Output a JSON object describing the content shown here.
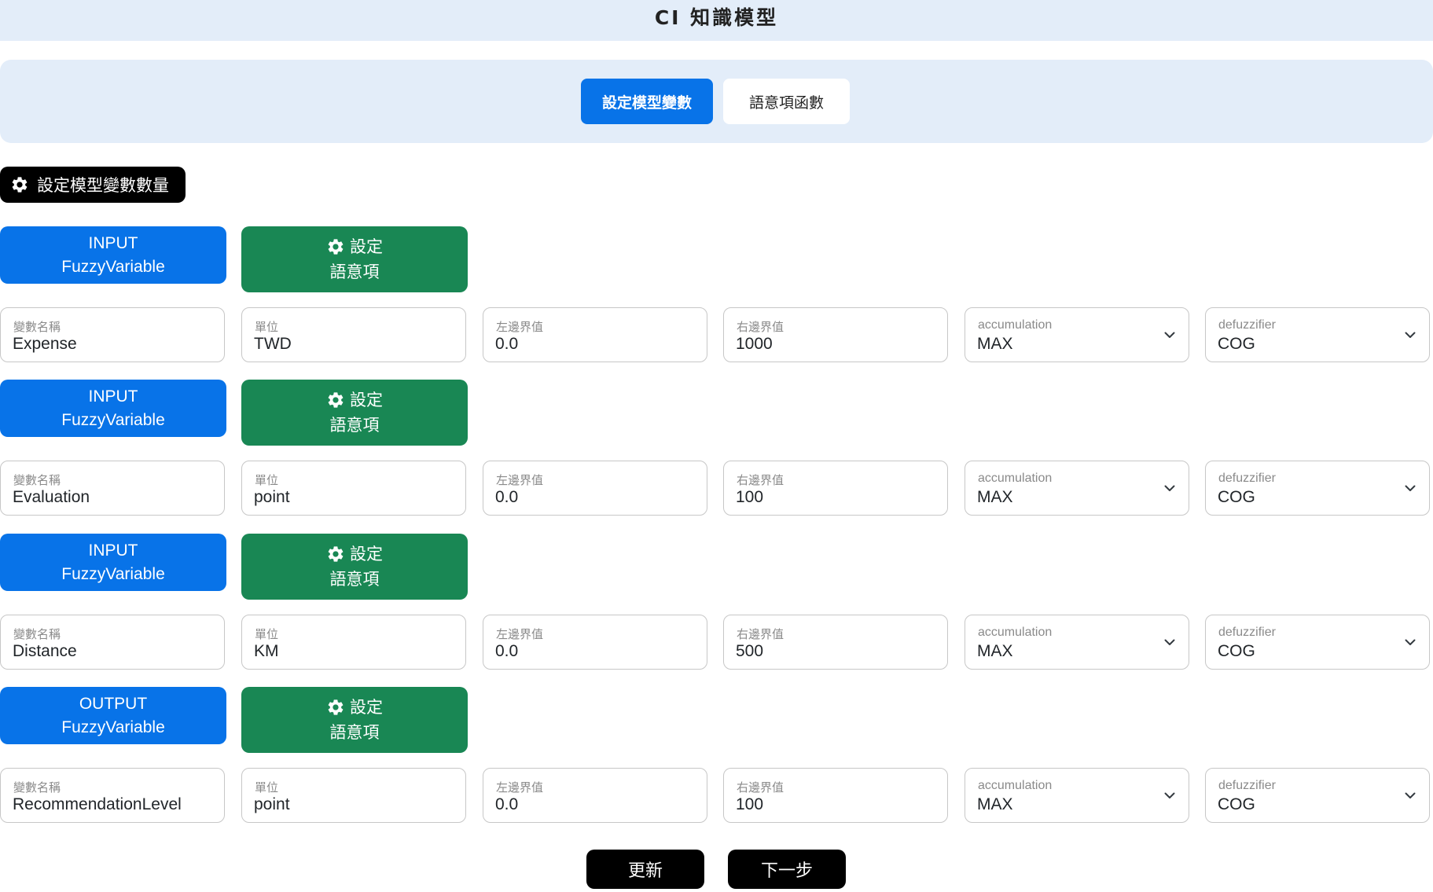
{
  "app": {
    "title": "CI 知識模型"
  },
  "tabs": [
    {
      "label": "設定模型變數",
      "active": true
    },
    {
      "label": "語意項函數",
      "active": false
    }
  ],
  "count_button": {
    "label": "設定模型變數數量",
    "icon": "gear-icon"
  },
  "term_button": {
    "line1": "設定",
    "line2": "語意項",
    "icon": "gear-icon"
  },
  "field_labels": {
    "name": "變數名稱",
    "unit": "單位",
    "left": "左邊界值",
    "right": "右邊界值",
    "accumulation": "accumulation",
    "defuzzifier": "defuzzifier"
  },
  "variables": [
    {
      "io": "INPUT",
      "type": "FuzzyVariable",
      "name": "Expense",
      "unit": "TWD",
      "left": "0.0",
      "right": "1000",
      "accumulation": "MAX",
      "defuzzifier": "COG"
    },
    {
      "io": "INPUT",
      "type": "FuzzyVariable",
      "name": "Evaluation",
      "unit": "point",
      "left": "0.0",
      "right": "100",
      "accumulation": "MAX",
      "defuzzifier": "COG"
    },
    {
      "io": "INPUT",
      "type": "FuzzyVariable",
      "name": "Distance",
      "unit": "KM",
      "left": "0.0",
      "right": "500",
      "accumulation": "MAX",
      "defuzzifier": "COG"
    },
    {
      "io": "OUTPUT",
      "type": "FuzzyVariable",
      "name": "RecommendationLevel",
      "unit": "point",
      "left": "0.0",
      "right": "100",
      "accumulation": "MAX",
      "defuzzifier": "COG"
    }
  ],
  "buttons": {
    "update": "更新",
    "next": "下一步"
  },
  "colors": {
    "primary": "#0873e8",
    "success": "#198754",
    "dark": "#000000",
    "panel": "#e3edf9"
  }
}
